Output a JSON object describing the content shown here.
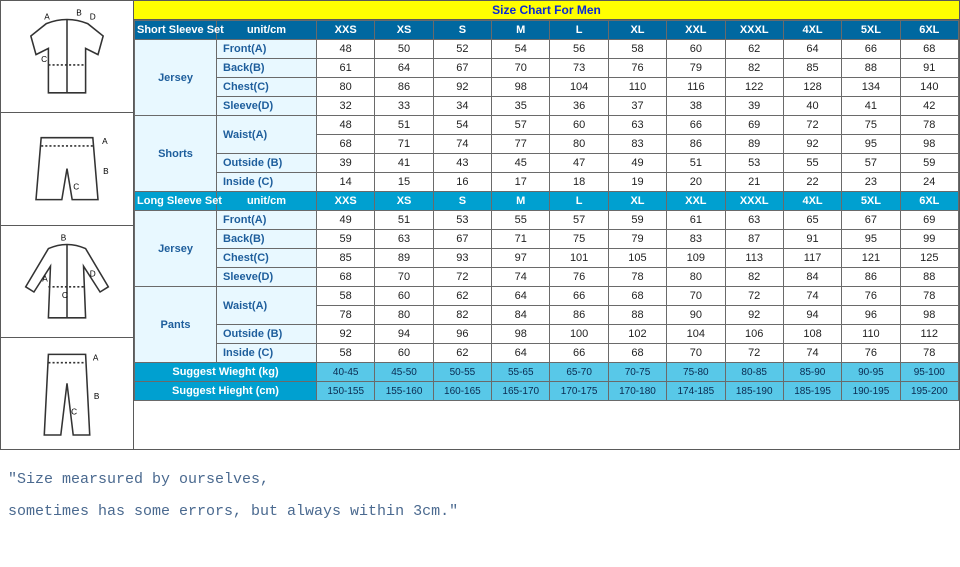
{
  "title": "Size Chart For Men",
  "sizes": [
    "XXS",
    "XS",
    "S",
    "M",
    "L",
    "XL",
    "XXL",
    "XXXL",
    "4XL",
    "5XL",
    "6XL"
  ],
  "sections": [
    {
      "name": "Short Sleeve Set",
      "unit": "unit/cm",
      "groups": [
        {
          "category": "Jersey",
          "rows": [
            {
              "label": "Front(A)",
              "vals": [
                48,
                50,
                52,
                54,
                56,
                58,
                60,
                62,
                64,
                66,
                68
              ]
            },
            {
              "label": "Back(B)",
              "vals": [
                61,
                64,
                67,
                70,
                73,
                76,
                79,
                82,
                85,
                88,
                91
              ]
            },
            {
              "label": "Chest(C)",
              "vals": [
                80,
                86,
                92,
                98,
                104,
                110,
                116,
                122,
                128,
                134,
                140
              ]
            },
            {
              "label": "Sleeve(D)",
              "vals": [
                32,
                33,
                34,
                35,
                36,
                37,
                38,
                39,
                40,
                41,
                42
              ]
            }
          ]
        },
        {
          "category": "Shorts",
          "rows": [
            {
              "label": "Waist(A)",
              "vals": [
                48,
                51,
                54,
                57,
                60,
                63,
                66,
                69,
                72,
                75,
                78
              ],
              "rowSpanLabel": 2
            },
            {
              "label": "",
              "vals": [
                68,
                71,
                74,
                77,
                80,
                83,
                86,
                89,
                92,
                95,
                98
              ],
              "hideLabel": true
            },
            {
              "label": "Outside (B)",
              "vals": [
                39,
                41,
                43,
                45,
                47,
                49,
                51,
                53,
                55,
                57,
                59
              ]
            },
            {
              "label": "Inside (C)",
              "vals": [
                14,
                15,
                16,
                17,
                18,
                19,
                20,
                21,
                22,
                23,
                24
              ]
            }
          ]
        }
      ]
    },
    {
      "name": "Long Sleeve Set",
      "unit": "unit/cm",
      "groups": [
        {
          "category": "Jersey",
          "rows": [
            {
              "label": "Front(A)",
              "vals": [
                49,
                51,
                53,
                55,
                57,
                59,
                61,
                63,
                65,
                67,
                69
              ]
            },
            {
              "label": "Back(B)",
              "vals": [
                59,
                63,
                67,
                71,
                75,
                79,
                83,
                87,
                91,
                95,
                99
              ]
            },
            {
              "label": "Chest(C)",
              "vals": [
                85,
                89,
                93,
                97,
                101,
                105,
                109,
                113,
                117,
                121,
                125
              ]
            },
            {
              "label": "Sleeve(D)",
              "vals": [
                68,
                70,
                72,
                74,
                76,
                78,
                80,
                82,
                84,
                86,
                88
              ]
            }
          ]
        },
        {
          "category": "Pants",
          "rows": [
            {
              "label": "Waist(A)",
              "vals": [
                58,
                60,
                62,
                64,
                66,
                68,
                70,
                72,
                74,
                76,
                78
              ],
              "rowSpanLabel": 2
            },
            {
              "label": "",
              "vals": [
                78,
                80,
                82,
                84,
                86,
                88,
                90,
                92,
                94,
                96,
                98
              ],
              "hideLabel": true
            },
            {
              "label": "Outside (B)",
              "vals": [
                92,
                94,
                96,
                98,
                100,
                102,
                104,
                106,
                108,
                110,
                112
              ]
            },
            {
              "label": "Inside (C)",
              "vals": [
                58,
                60,
                62,
                64,
                66,
                68,
                70,
                72,
                74,
                76,
                78
              ]
            }
          ]
        }
      ]
    }
  ],
  "suggest": {
    "weight_label": "Suggest Wieght (kg)",
    "weight_vals": [
      "40-45",
      "45-50",
      "50-55",
      "55-65",
      "65-70",
      "70-75",
      "75-80",
      "80-85",
      "85-90",
      "90-95",
      "95-100"
    ],
    "height_label": "Suggest Hieght (cm)",
    "height_vals": [
      "150-155",
      "155-160",
      "160-165",
      "165-170",
      "170-175",
      "170-180",
      "174-185",
      "185-190",
      "185-195",
      "190-195",
      "195-200"
    ]
  },
  "footnote_line1": "\"Size mearsured by ourselves,",
  "footnote_line2": "sometimes has some errors, but always within 3cm.\""
}
